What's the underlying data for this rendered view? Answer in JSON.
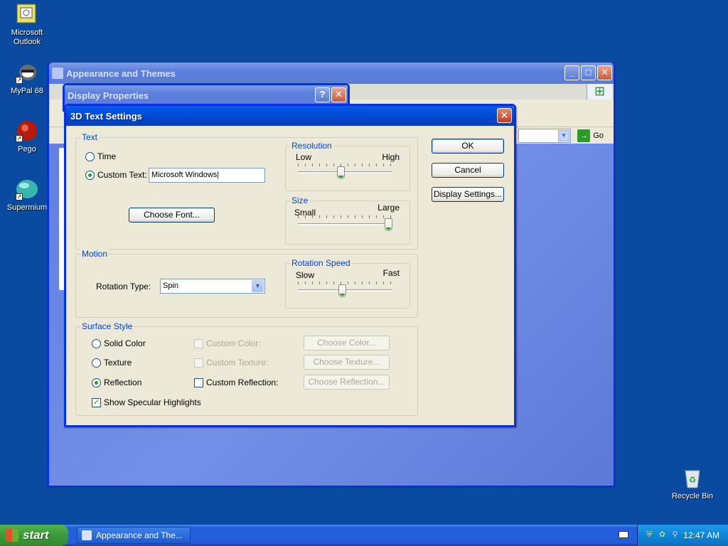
{
  "desktop": {
    "icons": [
      {
        "label": "Microsoft Outlook",
        "icon": "outlook-icon"
      },
      {
        "label": "MyPal 68",
        "icon": "mypal-icon"
      },
      {
        "label": "Pego",
        "icon": "pego-icon"
      },
      {
        "label": "Supermium",
        "icon": "supermium-icon"
      },
      {
        "label": "Recycle Bin",
        "icon": "recycle-bin-icon"
      }
    ]
  },
  "bg_window": {
    "title": "Appearance and Themes",
    "go_label": "Go"
  },
  "display_properties": {
    "title": "Display Properties"
  },
  "dialog": {
    "title": "3D Text Settings",
    "text_group": {
      "label": "Text",
      "time_label": "Time",
      "custom_text_label": "Custom Text:",
      "custom_text_value": "Microsoft Windows",
      "choose_font": "Choose Font..."
    },
    "resolution": {
      "label": "Resolution",
      "min_label": "Low",
      "max_label": "High",
      "value": 0.45
    },
    "size": {
      "label": "Size",
      "min_label": "Small",
      "max_label": "Large",
      "value": 1.0
    },
    "motion": {
      "label": "Motion",
      "rotation_type_label": "Rotation Type:",
      "rotation_type_value": "Spin"
    },
    "rotation_speed": {
      "label": "Rotation Speed",
      "min_label": "Slow",
      "max_label": "Fast",
      "value": 0.47
    },
    "surface": {
      "label": "Surface Style",
      "solid_color": "Solid Color",
      "texture": "Texture",
      "reflection": "Reflection",
      "custom_color": "Custom Color:",
      "custom_texture": "Custom Texture:",
      "custom_reflection": "Custom Reflection:",
      "choose_color": "Choose Color...",
      "choose_texture": "Choose Texture...",
      "choose_reflection": "Choose Reflection...",
      "show_specular": "Show Specular Highlights",
      "selected": "Reflection"
    },
    "buttons": {
      "ok": "OK",
      "cancel": "Cancel",
      "display_settings": "Display Settings..."
    }
  },
  "taskbar": {
    "start_label": "start",
    "task_label": "Appearance and The...",
    "clock": "12:47 AM"
  }
}
